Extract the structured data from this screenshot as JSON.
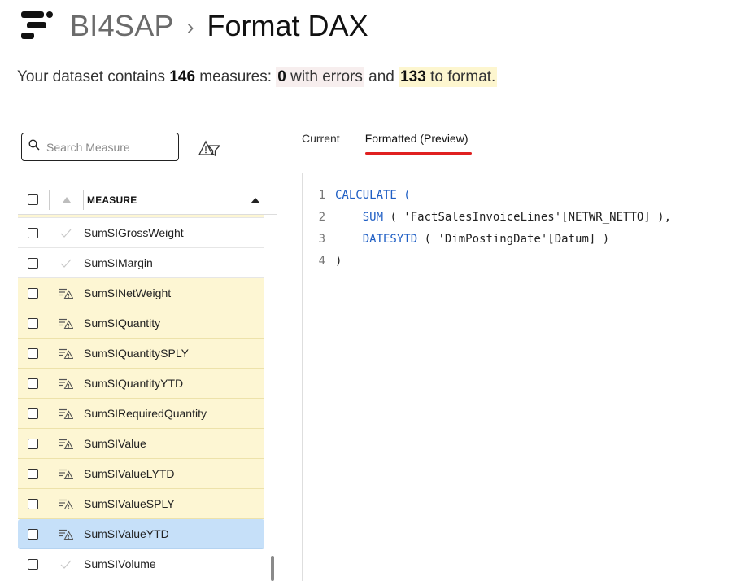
{
  "header": {
    "brand": "BI4SAP",
    "separator": "›",
    "title": "Format DAX"
  },
  "summary": {
    "prefix": "Your dataset contains ",
    "measures_count": "146",
    "measures_text": " measures: ",
    "errors_count": "0",
    "errors_text": " with errors",
    "and_text": " and ",
    "format_count": "133",
    "format_text": " to format."
  },
  "search": {
    "placeholder": "Search Measure",
    "value": ""
  },
  "table": {
    "column_header": "MEASURE",
    "rows": [
      {
        "name": "SumSIGrossWeight",
        "status": "ok",
        "selected": false
      },
      {
        "name": "SumSIMargin",
        "status": "ok",
        "selected": false
      },
      {
        "name": "SumSINetWeight",
        "status": "format",
        "selected": false
      },
      {
        "name": "SumSIQuantity",
        "status": "format",
        "selected": false
      },
      {
        "name": "SumSIQuantitySPLY",
        "status": "format",
        "selected": false
      },
      {
        "name": "SumSIQuantityYTD",
        "status": "format",
        "selected": false
      },
      {
        "name": "SumSIRequiredQuantity",
        "status": "format",
        "selected": false
      },
      {
        "name": "SumSIValue",
        "status": "format",
        "selected": false
      },
      {
        "name": "SumSIValueLYTD",
        "status": "format",
        "selected": false
      },
      {
        "name": "SumSIValueSPLY",
        "status": "format",
        "selected": false
      },
      {
        "name": "SumSIValueYTD",
        "status": "format",
        "selected": true
      },
      {
        "name": "SumSIVolume",
        "status": "ok",
        "selected": false
      }
    ]
  },
  "tabs": [
    {
      "label": "Current",
      "active": false
    },
    {
      "label": "Formatted (Preview)",
      "active": true
    }
  ],
  "code": {
    "lines": [
      {
        "num": "1",
        "text": "CALCULATE ("
      },
      {
        "num": "2",
        "text": "    SUM ( 'FactSalesInvoiceLines'[NETWR_NETTO] ),"
      },
      {
        "num": "3",
        "text": "    DATESYTD ( 'DimPostingDate'[Datum] )"
      },
      {
        "num": "4",
        "text": ")"
      }
    ]
  },
  "colors": {
    "format_row_bg": "#fdf6d3",
    "selected_row_bg": "#c6e0f9",
    "active_tab_underline": "#e02020",
    "keyword": "#1e5ec4"
  },
  "icons": {
    "logo": "bi4sap-logo",
    "search": "search-icon",
    "filter": "filter-warning-icon",
    "ok": "check-icon",
    "format": "format-warning-icon"
  }
}
